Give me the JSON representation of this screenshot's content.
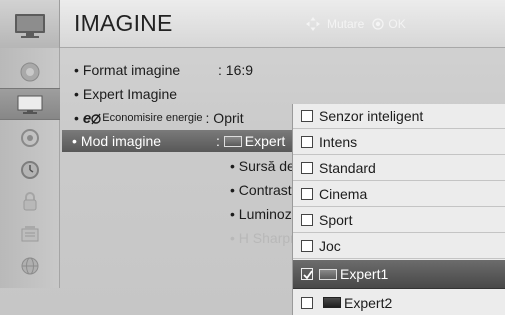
{
  "header": {
    "title": "IMAGINE",
    "hint_move": "Mutare",
    "hint_ok": "OK"
  },
  "menu_icons": [
    "clock-icon",
    "tv-screen-icon",
    "speaker-icon",
    "timer-icon",
    "lock-icon",
    "option-icon",
    "network-icon"
  ],
  "settings": [
    {
      "label": "Format imagine",
      "value": ": 16:9"
    },
    {
      "label": "Expert Imagine",
      "value": ""
    },
    {
      "logo": "e",
      "label": "Economisire energie",
      "value": ": Oprit"
    },
    {
      "label": "Mod imagine",
      "value": "Expert"
    }
  ],
  "sub_settings": [
    "• Sursă de lu",
    "• Contrast",
    "• Luminozit",
    "• H Sharpn"
  ],
  "dropdown": {
    "options": [
      {
        "label": "Senzor inteligent",
        "checked": false
      },
      {
        "label": "Intens",
        "checked": false
      },
      {
        "label": "Standard",
        "checked": false
      },
      {
        "label": "Cinema",
        "checked": false
      },
      {
        "label": "Sport",
        "checked": false
      },
      {
        "label": "Joc",
        "checked": false
      },
      {
        "label": "Expert1",
        "checked": true
      },
      {
        "label": "Expert2",
        "checked": false
      }
    ],
    "selected": "Expert1"
  }
}
